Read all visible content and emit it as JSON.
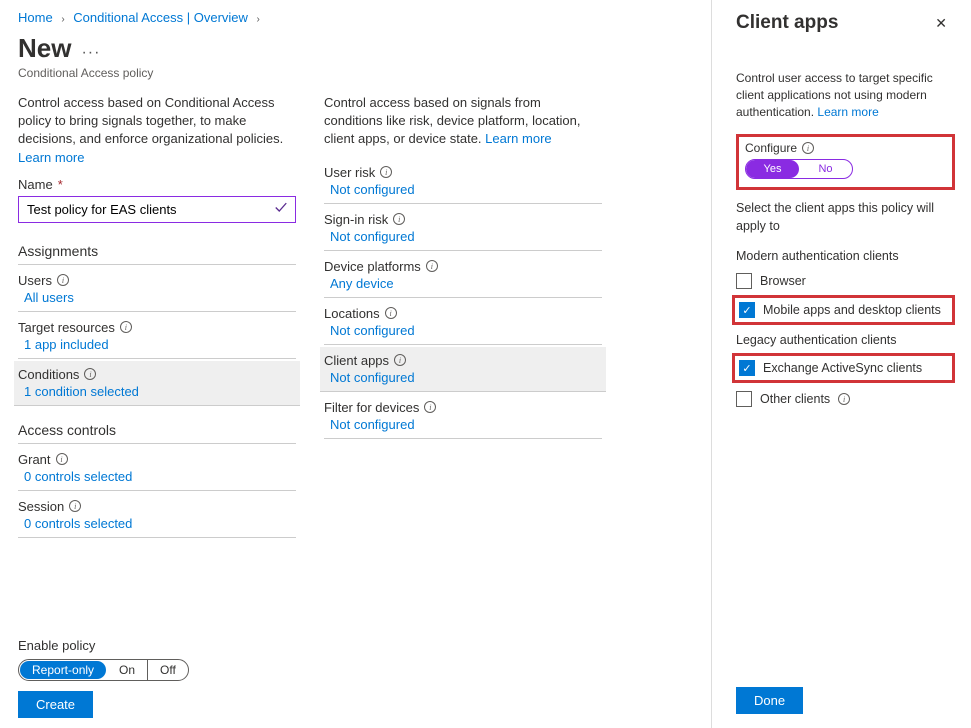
{
  "breadcrumb": {
    "home": "Home",
    "ca": "Conditional Access | Overview"
  },
  "page": {
    "title": "New",
    "subtitle": "Conditional Access policy",
    "ellipsis": "···"
  },
  "col1": {
    "desc": "Control access based on Conditional Access policy to bring signals together, to make decisions, and enforce organizational policies. ",
    "learn": "Learn more",
    "name_label": "Name",
    "name_value": "Test policy for EAS clients",
    "assignments_h": "Assignments",
    "users": {
      "label": "Users",
      "value": "All users"
    },
    "targets": {
      "label": "Target resources",
      "value": "1 app included"
    },
    "conditions": {
      "label": "Conditions",
      "value": "1 condition selected"
    },
    "access_h": "Access controls",
    "grant": {
      "label": "Grant",
      "value": "0 controls selected"
    },
    "session": {
      "label": "Session",
      "value": "0 controls selected"
    }
  },
  "col2": {
    "desc": "Control access based on signals from conditions like risk, device platform, location, client apps, or device state. ",
    "learn": "Learn more",
    "user_risk": {
      "label": "User risk",
      "value": "Not configured"
    },
    "signin_risk": {
      "label": "Sign-in risk",
      "value": "Not configured"
    },
    "device_platforms": {
      "label": "Device platforms",
      "value": "Any device"
    },
    "locations": {
      "label": "Locations",
      "value": "Not configured"
    },
    "client_apps": {
      "label": "Client apps",
      "value": "Not configured"
    },
    "filter": {
      "label": "Filter for devices",
      "value": "Not configured"
    }
  },
  "bottom": {
    "enable_label": "Enable policy",
    "opt1": "Report-only",
    "opt2": "On",
    "opt3": "Off",
    "create": "Create"
  },
  "panel": {
    "title": "Client apps",
    "desc": "Control user access to target specific client applications not using modern authentication. ",
    "learn": "Learn more",
    "configure": "Configure",
    "yes": "Yes",
    "no": "No",
    "select_text": "Select the client apps this policy will apply to",
    "modern_h": "Modern authentication clients",
    "browser": "Browser",
    "mobile": "Mobile apps and desktop clients",
    "legacy_h": "Legacy authentication clients",
    "eas": "Exchange ActiveSync clients",
    "other": "Other clients",
    "done": "Done"
  }
}
